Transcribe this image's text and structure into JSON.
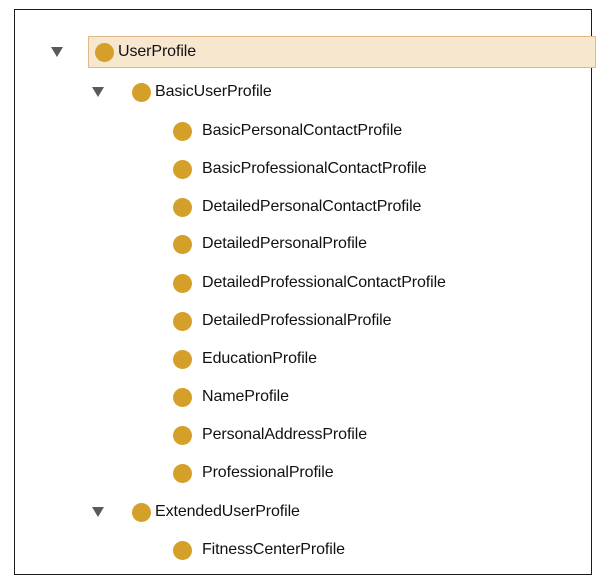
{
  "tree": {
    "root": {
      "label": "UserProfile",
      "expanded": true,
      "selected": true,
      "icon": "class-dot-icon"
    },
    "basic": {
      "label": "BasicUserProfile",
      "expanded": true,
      "icon": "class-dot-icon",
      "children": [
        "BasicPersonalContactProfile",
        "BasicProfessionalContactProfile",
        "DetailedPersonalContactProfile",
        "DetailedPersonalProfile",
        "DetailedProfessionalContactProfile",
        "DetailedProfessionalProfile",
        "EducationProfile",
        "NameProfile",
        "PersonalAddressProfile",
        "ProfessionalProfile"
      ]
    },
    "extended": {
      "label": "ExtendedUserProfile",
      "expanded": true,
      "icon": "class-dot-icon",
      "children": [
        "FitnessCenterProfile"
      ]
    }
  },
  "colors": {
    "class_dot": "#d4a02a",
    "selection_background": "#f7e7cf",
    "selection_border": "#e0b88a",
    "toggle": "#5a5a5a"
  }
}
